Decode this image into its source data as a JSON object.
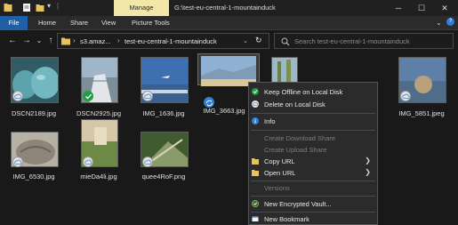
{
  "titlebar": {
    "manage_tab": "Manage",
    "path": "G:\\test-eu-central-1-mountainduck",
    "minimize": "─",
    "maximize": "☐",
    "close": "✕"
  },
  "ribbon": {
    "tabs": [
      "File",
      "Home",
      "Share",
      "View",
      "Picture Tools"
    ]
  },
  "navbar": {
    "back": "←",
    "forward": "→",
    "dropdown": "⌄",
    "up": "↑",
    "address_segments": [
      "s3.amaz...",
      "test-eu-central-1-mountainduck"
    ],
    "refresh": "↻",
    "search_placeholder": "Search test-eu-central-1-mountainduck"
  },
  "files": [
    {
      "name": "DSCN2189.jpg",
      "status": "cloud"
    },
    {
      "name": "DSCN2925.jpg",
      "status": "offline"
    },
    {
      "name": "IMG_1636.jpg",
      "status": "cloud"
    },
    {
      "name": "IMG_3663.jpg",
      "status": "syncing"
    },
    {
      "name": "IMG_5851.jpeg",
      "status": "cloud"
    },
    {
      "name": "IMG_6530.jpg",
      "status": "cloud"
    },
    {
      "name": "mieDa4li.jpg",
      "status": "cloud"
    },
    {
      "name": "quee4RoF.png",
      "status": "cloud"
    }
  ],
  "context_menu": {
    "items": [
      {
        "label": "Keep Offline on Local Disk",
        "icon": "check-circle-icon",
        "enabled": true
      },
      {
        "label": "Delete on Local Disk",
        "icon": "cloud-icon",
        "enabled": true
      },
      {
        "label": "Info",
        "icon": "info-icon",
        "enabled": true
      },
      {
        "label": "Create Download Share",
        "enabled": false
      },
      {
        "label": "Create Upload Share",
        "enabled": false
      },
      {
        "label": "Copy URL",
        "icon": "folder-icon",
        "enabled": true,
        "submenu": true
      },
      {
        "label": "Open URL",
        "icon": "folder-icon",
        "enabled": true,
        "submenu": true
      },
      {
        "label": "Versions",
        "enabled": false
      },
      {
        "label": "New Encrypted Vault...",
        "icon": "vault-icon",
        "enabled": true
      },
      {
        "label": "New Bookmark",
        "icon": "bookmark-icon",
        "enabled": true
      }
    ],
    "submenu_arrow": "❯"
  },
  "colors": {
    "accent": "#1f5fa8",
    "manage_tab": "#f2e7a6",
    "background": "#191919",
    "menu_background": "#2b2b2b",
    "offline_green": "#1e9e3e",
    "sync_blue": "#2f7fd6"
  }
}
